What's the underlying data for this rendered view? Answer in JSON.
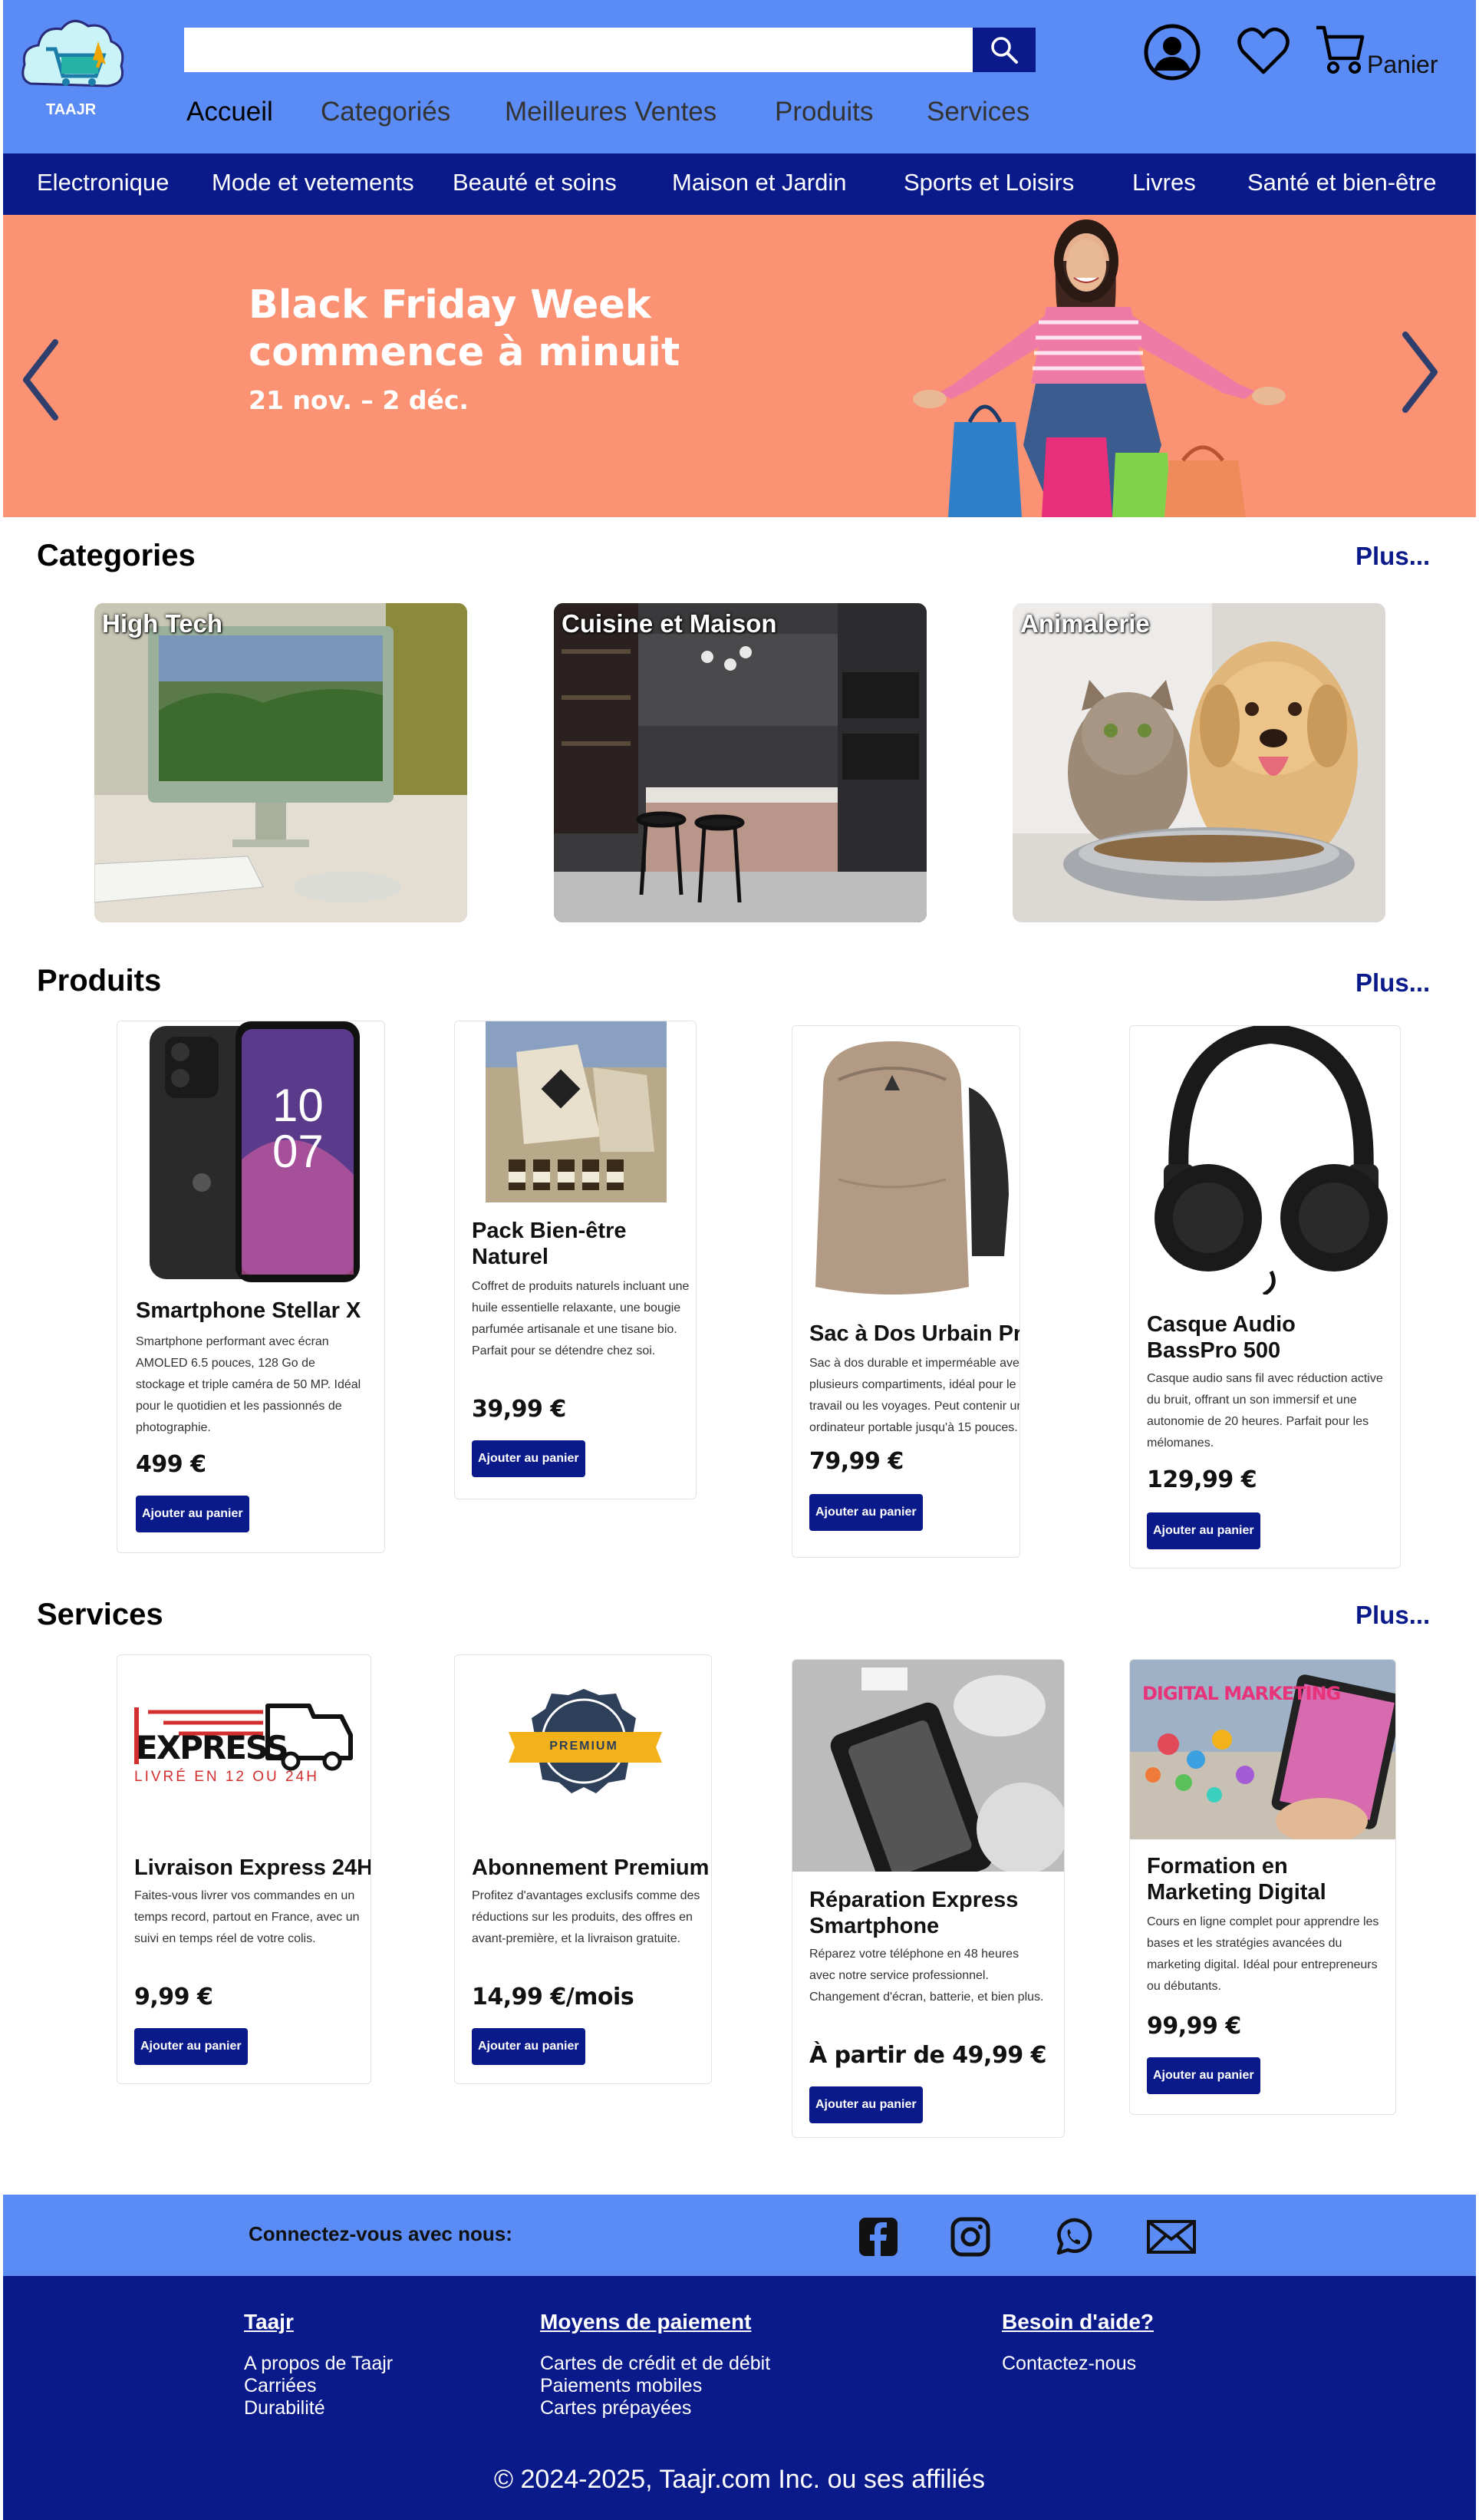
{
  "header": {
    "logo_text": "TAAJR",
    "search_placeholder": "",
    "cart_label": "Panier",
    "nav": [
      "Accueil",
      "Categoriés",
      "Meilleures Ventes",
      "Produits",
      "Services"
    ]
  },
  "category_bar": [
    "Electronique",
    "Mode et vetements",
    "Beauté et soins",
    "Maison et Jardin",
    "Sports et Loisirs",
    "Livres",
    "Santé et bien-être"
  ],
  "hero": {
    "line1": "Black Friday Week",
    "line2": "commence à minuit",
    "line3": "21 nov. – 2 déc."
  },
  "categories": {
    "title": "Categories",
    "more": "Plus...",
    "items": [
      "High Tech",
      "Cuisine et Maison",
      "Animalerie"
    ]
  },
  "products": {
    "title": "Produits",
    "more": "Plus...",
    "button": "Ajouter au panier",
    "items": [
      {
        "title": "Smartphone Stellar X",
        "desc": "Smartphone performant avec écran AMOLED 6.5 pouces, 128 Go de stockage et triple caméra de 50 MP. Idéal pour le quotidien et les passionnés de photographie.",
        "price": "499 €"
      },
      {
        "title": "Pack Bien-être Naturel",
        "desc": "Coffret de produits naturels incluant une huile essentielle relaxante, une bougie parfumée artisanale et une tisane bio. Parfait pour se détendre chez soi.",
        "price": "39,99 €"
      },
      {
        "title": "Sac à Dos Urbain Pro",
        "desc": "Sac à dos durable et imperméable avec plusieurs compartiments, idéal pour le travail ou les voyages. Peut contenir un ordinateur portable jusqu'à 15 pouces.",
        "price": "79,99 €"
      },
      {
        "title": "Casque Audio BassPro 500",
        "desc": "Casque audio sans fil avec réduction active du bruit, offrant un son immersif et une autonomie de 20 heures. Parfait pour les mélomanes.",
        "price": "129,99 €"
      }
    ]
  },
  "services": {
    "title": "Services",
    "more": "Plus...",
    "button": "Ajouter au panier",
    "items": [
      {
        "title": "Livraison Express 24H",
        "desc": "Faites-vous livrer vos commandes en un temps record, partout en France, avec un suivi en temps réel de votre colis.",
        "price": "9,99 €",
        "logo_main": "EXPRESS",
        "logo_sub": "LIVRÉ EN 12 OU 24H"
      },
      {
        "title": "Abonnement Premium",
        "desc": "Profitez d'avantages exclusifs comme des réductions sur les produits, des offres en avant-première, et la livraison gratuite.",
        "price": "14,99 €/mois",
        "badge": "PREMIUM"
      },
      {
        "title": "Réparation Express Smartphone",
        "desc": "Réparez votre téléphone en 48 heures avec notre service professionnel. Changement d'écran, batterie, et bien plus.",
        "price": "À partir de 49,99 €"
      },
      {
        "title": "Formation en Marketing Digital",
        "desc": "Cours en ligne complet pour apprendre les bases et les stratégies avancées du marketing digital. Idéal pour entrepreneurs ou débutants.",
        "price": "99,99 €",
        "banner": "DIGITAL MARKETING"
      }
    ]
  },
  "social": {
    "label": "Connectez-vous avec nous:"
  },
  "footer": {
    "col1": {
      "title": "Taajr",
      "links": [
        "A propos de Taajr",
        "Carriées",
        "Durabilité"
      ]
    },
    "col2": {
      "title": "Moyens de paiement",
      "links": [
        "Cartes de crédit et de débit",
        "Paiements mobiles",
        "Cartes prépayées"
      ]
    },
    "col3": {
      "title": "Besoin d'aide?",
      "links": [
        "Contactez-nous"
      ]
    },
    "copyright": "© 2024-2025, Taajr.com Inc. ou ses affiliés"
  },
  "colors": {
    "primary": "#0a1a8a",
    "header": "#5b8cf5",
    "hero": "#fc9274"
  }
}
